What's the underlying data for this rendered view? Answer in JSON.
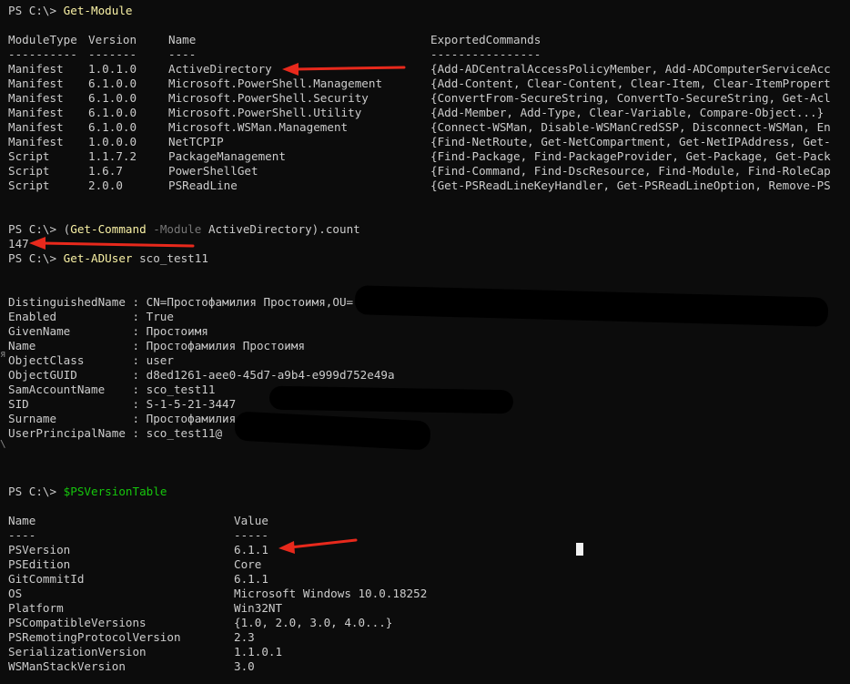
{
  "commands": {
    "prompt": "PS C:\\>",
    "get_module": "Get-Module",
    "gc_open": "(",
    "gc_cmd": "Get-Command",
    "gc_param": "-Module",
    "gc_arg": "ActiveDirectory",
    "gc_close": ").count",
    "count_result": "147",
    "get_aduser": "Get-ADUser",
    "aduser_arg": "sco_test11",
    "psversiontable": "$PSVersionTable"
  },
  "modules": {
    "headers": [
      "ModuleType",
      "Version",
      "Name",
      "ExportedCommands"
    ],
    "dividers": [
      "----------",
      "-------",
      "----",
      "----------------"
    ],
    "rows": [
      [
        "Manifest",
        "1.0.1.0",
        "ActiveDirectory",
        "{Add-ADCentralAccessPolicyMember, Add-ADComputerServiceAcc"
      ],
      [
        "Manifest",
        "6.1.0.0",
        "Microsoft.PowerShell.Management",
        "{Add-Content, Clear-Content, Clear-Item, Clear-ItemPropert"
      ],
      [
        "Manifest",
        "6.1.0.0",
        "Microsoft.PowerShell.Security",
        "{ConvertFrom-SecureString, ConvertTo-SecureString, Get-Acl"
      ],
      [
        "Manifest",
        "6.1.0.0",
        "Microsoft.PowerShell.Utility",
        "{Add-Member, Add-Type, Clear-Variable, Compare-Object...}"
      ],
      [
        "Manifest",
        "6.1.0.0",
        "Microsoft.WSMan.Management",
        "{Connect-WSMan, Disable-WSManCredSSP, Disconnect-WSMan, En"
      ],
      [
        "Manifest",
        "1.0.0.0",
        "NetTCPIP",
        "{Find-NetRoute, Get-NetCompartment, Get-NetIPAddress, Get-"
      ],
      [
        "Script",
        "1.1.7.2",
        "PackageManagement",
        "{Find-Package, Find-PackageProvider, Get-Package, Get-Pack"
      ],
      [
        "Script",
        "1.6.7",
        "PowerShellGet",
        "{Find-Command, Find-DscResource, Find-Module, Find-RoleCap"
      ],
      [
        "Script",
        "2.0.0",
        "PSReadLine",
        "{Get-PSReadLineKeyHandler, Get-PSReadLineOption, Remove-PS"
      ]
    ]
  },
  "aduser": [
    "DistinguishedName : CN=Простофамилия Простоимя,OU=",
    "Enabled           : True",
    "GivenName         : Простоимя",
    "Name              : Простофамилия Простоимя",
    "ObjectClass       : user",
    "ObjectGUID        : d8ed1261-aee0-45d7-a9b4-e999d752e49a",
    "SamAccountName    : sco_test11",
    "SID               : S-1-5-21-3447",
    "Surname           : Простофамилия",
    "UserPrincipalName : sco_test11@"
  ],
  "psversion": {
    "headers": [
      "Name",
      "Value"
    ],
    "dividers": [
      "----",
      "-----"
    ],
    "rows": [
      [
        "PSVersion",
        "6.1.1"
      ],
      [
        "PSEdition",
        "Core"
      ],
      [
        "GitCommitId",
        "6.1.1"
      ],
      [
        "OS",
        "Microsoft Windows 10.0.18252"
      ],
      [
        "Platform",
        "Win32NT"
      ],
      [
        "PSCompatibleVersions",
        "{1.0, 2.0, 3.0, 4.0...}"
      ],
      [
        "PSRemotingProtocolVersion",
        "2.3"
      ],
      [
        "SerializationVersion",
        "1.1.0.1"
      ],
      [
        "WSManStackVersion",
        "3.0"
      ]
    ]
  },
  "edge_marks": [
    "я",
    "\\"
  ],
  "colors": {
    "background": "#0c0c0c",
    "text": "#cccccc",
    "command": "#f9f1a5",
    "parameter": "#767676",
    "variable": "#16c60c",
    "arrow": "#e8291c",
    "cursor": "#f2f2f2"
  }
}
